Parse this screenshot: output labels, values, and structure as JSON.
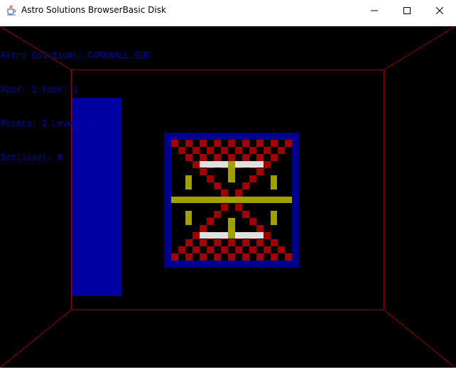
{
  "window": {
    "title": "Astro Solutions BrowserBasic Disk",
    "icon": "java-cup-icon",
    "controls": [
      "minimize-icon",
      "maximize-icon",
      "close-icon"
    ]
  },
  "hud": {
    "line1": "Astro Solutions: DARKWALL SUD",
    "line2": "Xpos: 2 Ypos: 1",
    "line3": "Points: 2 Level: 1",
    "line4": "Schlüssel: 0"
  },
  "colors": {
    "background": "#000000",
    "wireframe": "#9a0000",
    "hud_text": "#0000b8",
    "side_door": "#0000a0",
    "panel_border": "#000090",
    "checker_red": "#a00000",
    "checker_dark": "#000000",
    "glyph_yellow": "#a0a000",
    "glyph_white": "#e0e0e0"
  }
}
